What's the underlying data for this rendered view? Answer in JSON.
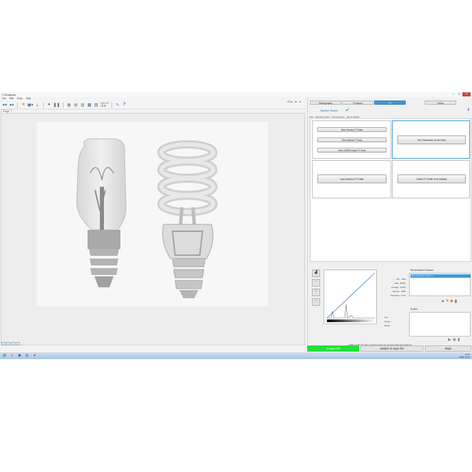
{
  "window": {
    "title": "CTAnalyser"
  },
  "menu": [
    "File",
    "Edit",
    "Tools",
    "Help"
  ],
  "toolbar": {
    "zoom_label": "Fit to",
    "mode_label_1": "1(1) 1:1",
    "mode_label_2": "16 bit"
  },
  "viewer": {
    "tab_label": "Image"
  },
  "right_panel": {
    "tabs": [
      "Radiography",
      "Program",
      "CT",
      "Setup"
    ],
    "active_tab": "CT",
    "system_status": "System Status",
    "subtabs": [
      "Start",
      "Reference Scans",
      "Reconstruction",
      "Export Dataset"
    ],
    "buttons": {
      "new_circular": "New Circular CT Scan",
      "new_helical": "New Helical CT Scan",
      "new_large": "New LARGE Angle CT Scan",
      "use_params": "Use Parameters of Last Scan",
      "use_autozero": "Use Autozero CT Profile",
      "select_ct": "Select CT Profile From Dataset"
    },
    "stats": [
      {
        "label": "Min",
        "value": "7600"
      },
      {
        "label": "Max",
        "value": "39600"
      },
      {
        "label": "Average",
        "value": "11760"
      },
      {
        "label": "Std Dev",
        "value": "5050"
      },
      {
        "label": "Saturation",
        "value": "0.1%"
      }
    ],
    "reconstruction_title": "Reconstructed Volumes",
    "reconstruction_item": "Reconstructed Volume 1",
    "profiles_title": "Profiles",
    "position_labels": [
      "Pos:",
      "Range:",
      "Detail:"
    ],
    "footer_note": "1280 X 1024 @ mAs; a protocol when an argument file was loaded at",
    "xray_off": "X-rays Off",
    "xray_on": "Switch X-rays On",
    "stop": "Stop"
  },
  "taskbar": {
    "time": "11:27",
    "date": "2016-12-07"
  },
  "colors": {
    "accent": "#3d9ad8",
    "xray_off": "#22e03a"
  }
}
